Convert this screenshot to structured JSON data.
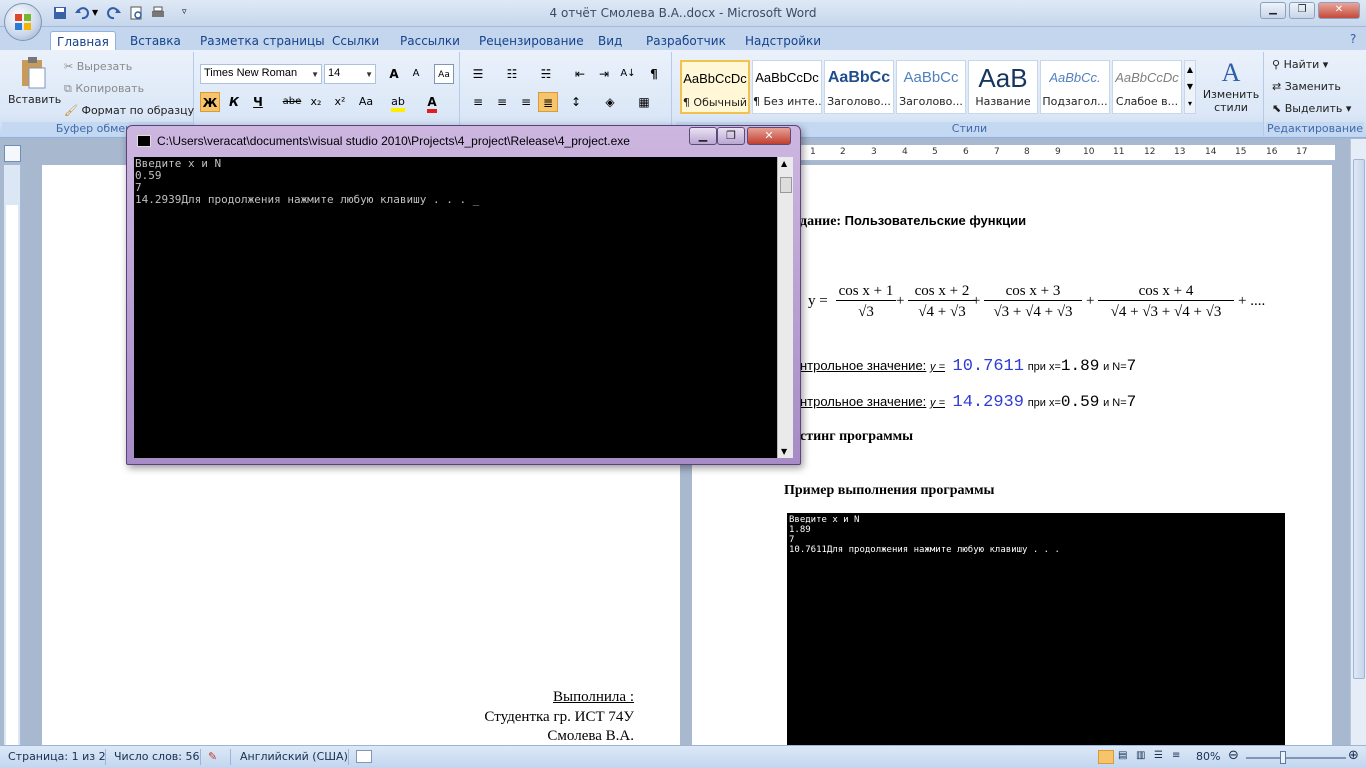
{
  "app": {
    "window_title": "4 отчёт Смолева В.А..docx - Microsoft Word"
  },
  "tabs": [
    "Главная",
    "Вставка",
    "Разметка страницы",
    "Ссылки",
    "Рассылки",
    "Рецензирование",
    "Вид",
    "Разработчик",
    "Надстройки"
  ],
  "ribbon": {
    "clipboard": {
      "paste_label": "Вставить",
      "cut_label": "Вырезать",
      "copy_label": "Копировать",
      "format_painter_label": "Формат по образцу",
      "group_label": "Буфер обмена"
    },
    "font": {
      "font_name": "Times New Roman",
      "font_size": "14",
      "bold": "Ж",
      "italic": "К",
      "underline": "Ч",
      "strike": "abe",
      "change_case": "Aa",
      "grow": "A",
      "shrink": "A"
    },
    "styles": {
      "items": [
        {
          "sample": "AaBbCcDc",
          "name": "¶ Обычный"
        },
        {
          "sample": "AaBbCcDc",
          "name": "¶ Без инте..."
        },
        {
          "sample": "AaBbCc",
          "name": "Заголово..."
        },
        {
          "sample": "AaBbCc",
          "name": "Заголово..."
        },
        {
          "sample": "AaB",
          "name": "Название"
        },
        {
          "sample": "AaBbCc.",
          "name": "Подзагол..."
        },
        {
          "sample": "AaBbCcDc",
          "name": "Слабое в..."
        }
      ],
      "change_styles_label": "Изменить стили",
      "group_label": "Стили"
    },
    "editing": {
      "find_label": "Найти",
      "replace_label": "Заменить",
      "select_label": "Выделить",
      "group_label": "Редактирование"
    }
  },
  "ruler": {
    "ticks": [
      "1",
      "2",
      "3",
      "4",
      "5",
      "6",
      "7",
      "8",
      "9",
      "10",
      "11",
      "12",
      "13",
      "14",
      "15",
      "16",
      "17"
    ]
  },
  "page1": {
    "performed_label": "Выполнила :",
    "student_label": "Студентка гр. ИСТ 74У",
    "student_name": "Смолева В.А."
  },
  "page2": {
    "task_prefix": "дание:",
    "task_text": "Пользовательские функции",
    "formula": {
      "y": "y =",
      "t1_num": "cos x + 1",
      "t1_den": "√3",
      "t2_num": "cos x + 2",
      "t2_den": "√4 + √3",
      "t3_num": "cos x + 3",
      "t3_den": "√3 + √4 + √3",
      "t4_num": "cos x + 4",
      "t4_den": "√4 + √3 + √4 + √3",
      "tail": "+ ...."
    },
    "control1": {
      "label": "нтрольное значение:",
      "y_label": "y =",
      "value": "10.7611",
      "at_x": "при x=",
      "x_value": "1.89",
      "and_n": "и N=",
      "n_value": "7"
    },
    "control2": {
      "label": "нтрольное значение:",
      "y_label": "y =",
      "value": "14.2939",
      "at_x": "при x=",
      "x_value": "0.59",
      "and_n": "и N=",
      "n_value": "7"
    },
    "listing_heading": "стинг программы",
    "example_heading": "Пример выполнения программы",
    "screenshot_lines": [
      "Введите x и N",
      "1.89",
      "7",
      "10.7611Для продолжения нажмите любую клавишу . . ."
    ]
  },
  "console": {
    "title": "C:\\Users\\veracat\\documents\\visual studio 2010\\Projects\\4_project\\Release\\4_project.exe",
    "lines": [
      "Введите x и N",
      "0.59",
      "7",
      "14.2939Для продолжения нажмите любую клавишу . . . _"
    ]
  },
  "status": {
    "page": "Страница: 1 из 2",
    "words": "Число слов: 56",
    "language": "Английский (США)",
    "zoom": "80%"
  },
  "colors": {
    "accent": "#15428b",
    "console_frame": "#a78bc6",
    "control_value": "#2f3cd6"
  }
}
